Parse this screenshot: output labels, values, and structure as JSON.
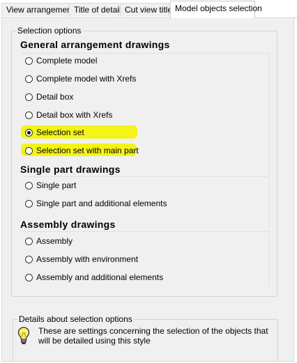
{
  "tabs": [
    {
      "label": "View arrangement",
      "active": false
    },
    {
      "label": "Title of detail",
      "active": false
    },
    {
      "label": "Cut view title",
      "active": false
    },
    {
      "label": "Model objects selection",
      "active": true
    }
  ],
  "selection_options": {
    "legend": "Selection options",
    "general": {
      "heading": "General arrangement drawings",
      "options": [
        {
          "label": "Complete model",
          "checked": false
        },
        {
          "label": "Complete model with Xrefs",
          "checked": false
        },
        {
          "label": "Detail box",
          "checked": false
        },
        {
          "label": "Detail box with Xrefs",
          "checked": false
        },
        {
          "label": "Selection set",
          "checked": true
        },
        {
          "label": "Selection set with main part",
          "checked": false
        }
      ]
    },
    "single": {
      "heading": "Single part drawings",
      "options": [
        {
          "label": "Single part",
          "checked": false
        },
        {
          "label": "Single part and additional elements",
          "checked": false
        }
      ]
    },
    "assembly": {
      "heading": "Assembly drawings",
      "options": [
        {
          "label": "Assembly",
          "checked": false
        },
        {
          "label": "Assembly with environment",
          "checked": false
        },
        {
          "label": "Assembly and additional elements",
          "checked": false
        }
      ]
    }
  },
  "details": {
    "legend": "Details about selection options",
    "text": "These are settings concerning the selection of the objects that will be detailed using this style",
    "icon": "lightbulb-icon"
  },
  "colors": {
    "highlight": "#f4f400",
    "panel_bg": "#f0f0f0"
  }
}
